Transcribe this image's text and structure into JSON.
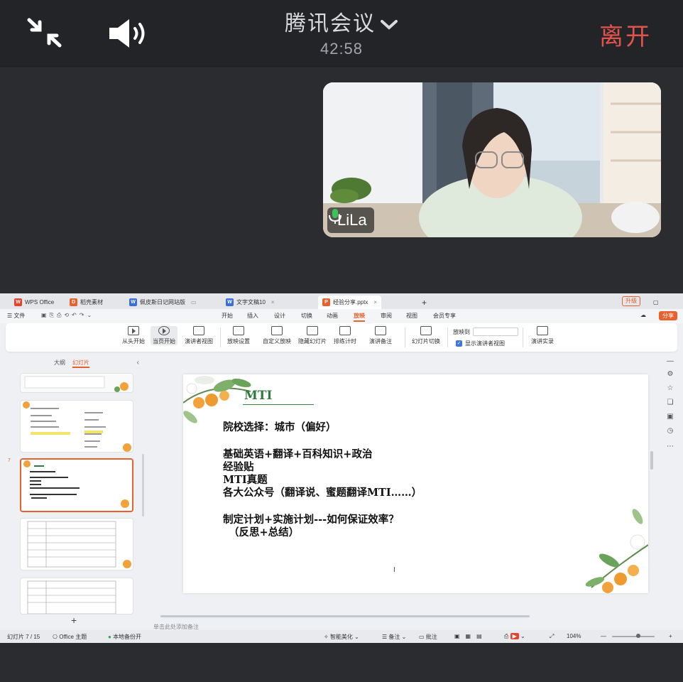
{
  "meeting": {
    "title": "腾讯会议",
    "timer": "42:58",
    "leave_label": "离开",
    "participant_name": "LiLa",
    "colors": {
      "leave": "#e3534e",
      "background": "#222427"
    }
  },
  "wps": {
    "tabs": [
      {
        "label": "WPS Office",
        "icon": "wps-logo-icon"
      },
      {
        "label": "稻壳素材",
        "icon": "docer-icon"
      },
      {
        "label": "佩皮斯日记网站版",
        "icon": "word-doc-icon"
      },
      {
        "label": "文字文稿10",
        "icon": "word-doc-icon"
      },
      {
        "label": "经验分享.pptx",
        "icon": "ppt-icon"
      }
    ],
    "upgrade_label": "升级",
    "file_menu": "文件",
    "menu": [
      "开始",
      "插入",
      "设计",
      "切换",
      "动画",
      "放映",
      "审阅",
      "视图",
      "会员专享"
    ],
    "active_menu": "放映",
    "share_label": "分享",
    "ribbon": {
      "from_start": "从头开始",
      "from_current": "当页开始",
      "presenter_view": "演讲者视图",
      "slideshow_settings": "放映设置",
      "custom_show": "自定义放映",
      "hide_slide": "隐藏幻灯片",
      "rehearse": "排练计时",
      "speaker_notes": "演讲备注",
      "slide_switch": "幻灯片切换",
      "show_to": "放映到",
      "show_presenter": "显示演讲者视图",
      "record": "演讲实录"
    },
    "left_panel": {
      "outline_tab": "大纲",
      "slides_tab": "幻灯片",
      "active_slide_number": "7"
    },
    "slide": {
      "title": "MTI",
      "lines": [
        "院校选择：城市（偏好）",
        "",
        "基础英语+翻译+百科知识+政治",
        "经验贴",
        "MTI真题",
        "各大公众号（翻译说、蜜题翻译MTI……）",
        "",
        "制定计划+实施计划---如何保证效率？",
        "（反思+总结）"
      ]
    },
    "notes_placeholder": "单击此处添加备注",
    "status": {
      "slide_counter": "幻灯片 7 / 15",
      "theme": "Office 主题",
      "backup": "本地备份开",
      "beautify": "智能美化",
      "notes": "备注",
      "comments": "批注",
      "zoom": "104%"
    }
  }
}
